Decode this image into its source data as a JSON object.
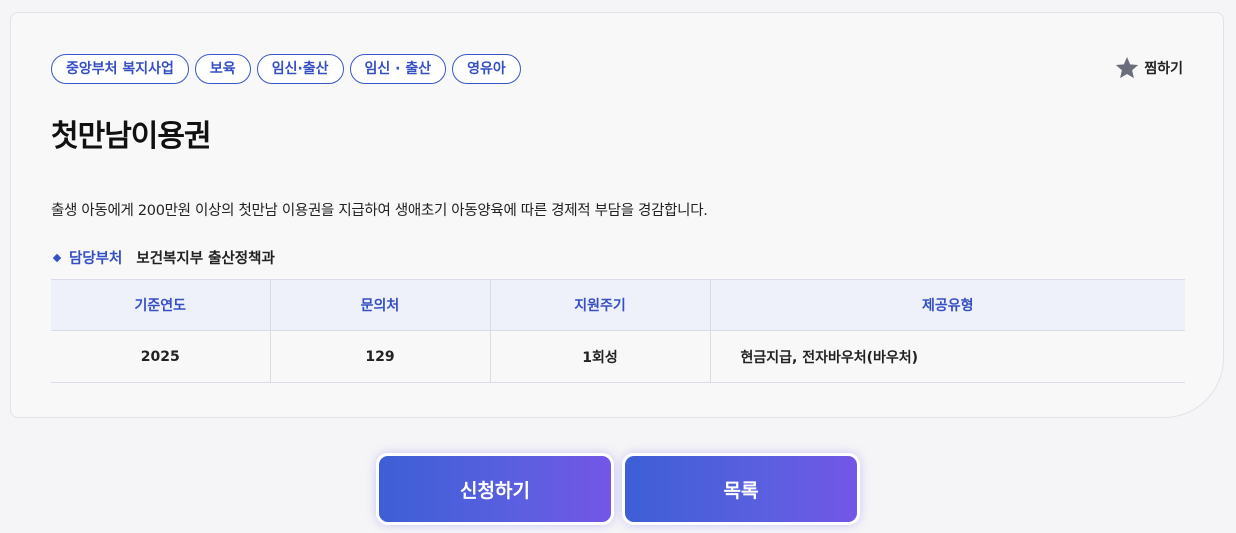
{
  "tags": [
    "중앙부처 복지사업",
    "보육",
    "임신·출산",
    "임신 · 출산",
    "영유아"
  ],
  "favorite": {
    "label": "찜하기",
    "icon": "star-icon",
    "color": "#6b6d7b"
  },
  "title": "첫만남이용권",
  "description": "출생 아동에게 200만원 이상의 첫만남 이용권을 지급하여 생애초기 아동양육에 따른 경제적 부담을 경감합니다.",
  "department": {
    "label": "담당부처",
    "value": "보건복지부 출산정책과"
  },
  "table": {
    "headers": [
      "기준연도",
      "문의처",
      "지원주기",
      "제공유형"
    ],
    "row": [
      "2025",
      "129",
      "1회성",
      "현금지급, 전자바우처(바우처)"
    ]
  },
  "buttons": {
    "apply": "신청하기",
    "list": "목록"
  },
  "colors": {
    "accent": "#3550c4",
    "button_start": "#3d5fd6",
    "button_end": "#7356e6"
  }
}
